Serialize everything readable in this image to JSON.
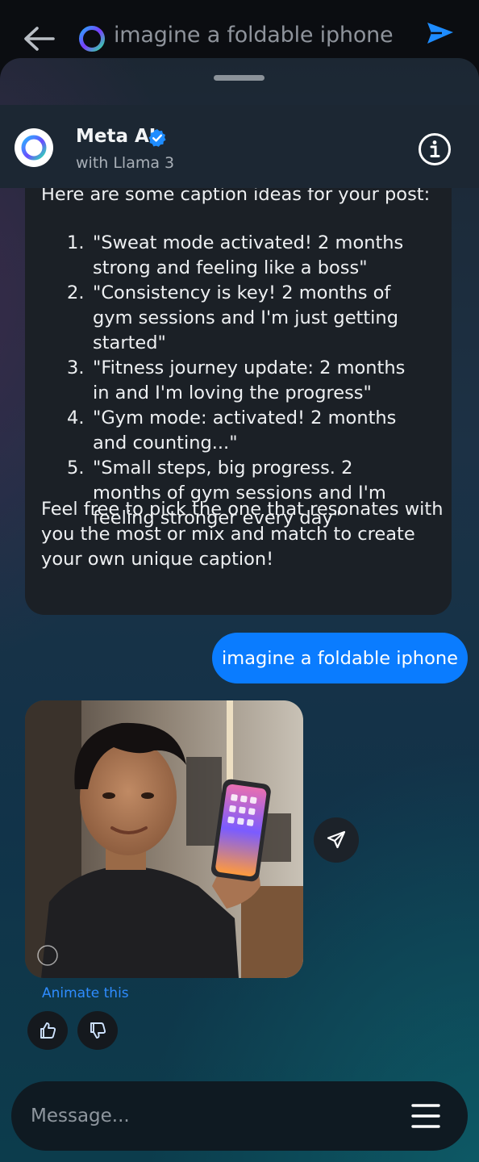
{
  "topbar": {
    "search_query": "imagine a foldable iphone",
    "back_icon": "arrow-left-icon",
    "send_icon": "send-icon"
  },
  "header": {
    "bot_name": "Meta AI",
    "bot_subtitle": "with Llama 3",
    "verified_icon": "verified-badge-icon",
    "info_icon": "info-icon"
  },
  "messages": {
    "bot_reply": {
      "intro": "Here are some caption ideas for your post:",
      "captions": [
        {
          "num": "1.",
          "text": "\"Sweat mode activated! 2 months strong and feeling like a boss\""
        },
        {
          "num": "2.",
          "text": "\"Consistency is key! 2 months of gym sessions and I'm just getting started\""
        },
        {
          "num": "3.",
          "text": "\"Fitness journey update: 2 months in and I'm loving the progress\""
        },
        {
          "num": "4.",
          "text": "\"Gym mode: activated! 2 months and counting...\""
        },
        {
          "num": "5.",
          "text": "\"Small steps, big progress. 2 months of gym sessions and I'm feeling stronger every day\""
        }
      ],
      "outro": "Feel free to pick the one that resonates with you the most or mix and match to create your own unique caption!"
    },
    "user_prompt": "imagine a foldable iphone",
    "image_actions": {
      "animate_label": "Animate this",
      "like_icon": "thumbs-up-icon",
      "dislike_icon": "thumbs-down-icon",
      "share_icon": "paper-plane-icon"
    }
  },
  "composer": {
    "placeholder": "Message...",
    "menu_icon": "menu-icon"
  },
  "colors": {
    "accent": "#0a7cff",
    "link": "#2e8cff",
    "bubble_bot": "#1b2026"
  }
}
